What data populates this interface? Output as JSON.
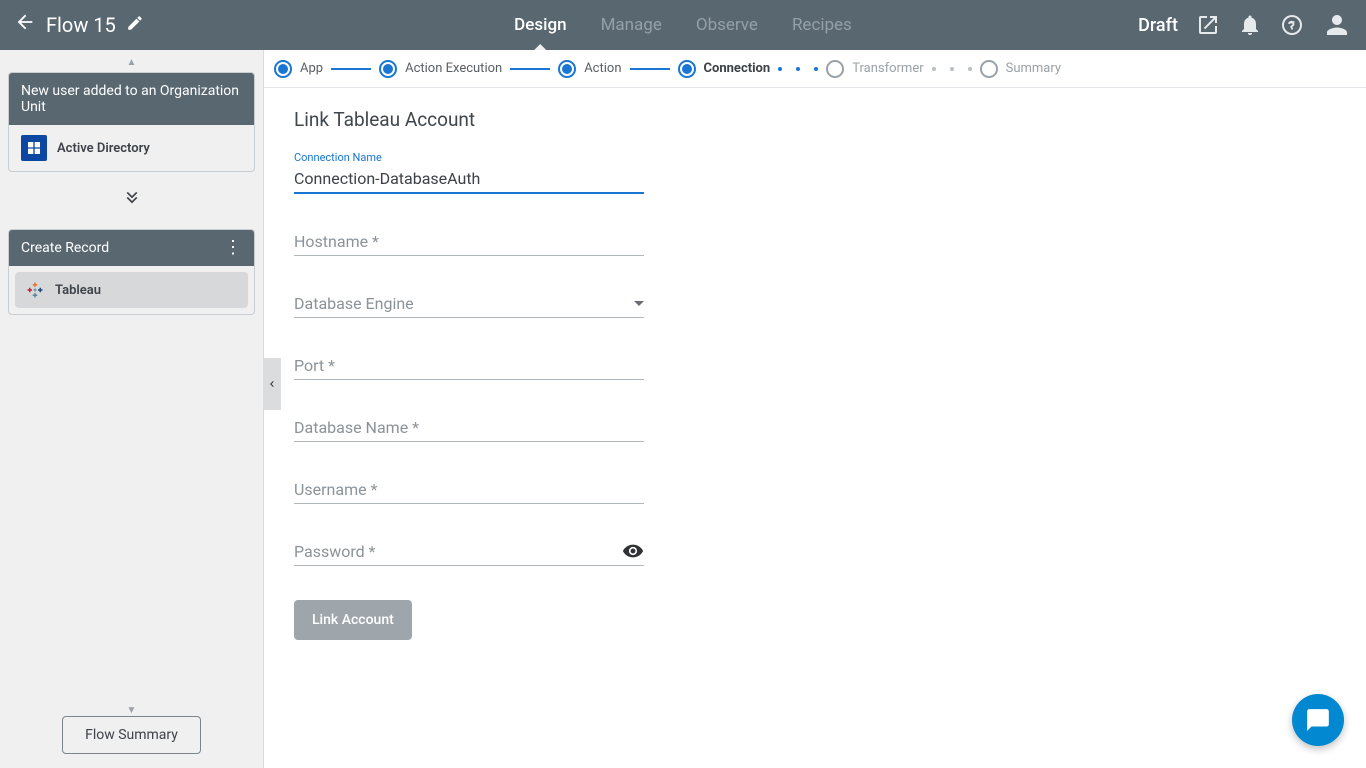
{
  "header": {
    "title": "Flow 15",
    "tabs": [
      "Design",
      "Manage",
      "Observe",
      "Recipes"
    ],
    "active_tab": 0,
    "status": "Draft"
  },
  "sidebar": {
    "trigger": {
      "title": "New user added to an Organization Unit",
      "app": "Active Directory"
    },
    "action": {
      "title": "Create Record",
      "app": "Tableau"
    },
    "summary_button": "Flow Summary"
  },
  "stepper": {
    "steps": [
      {
        "label": "App",
        "state": "done"
      },
      {
        "label": "Action Execution",
        "state": "done"
      },
      {
        "label": "Action",
        "state": "done"
      },
      {
        "label": "Connection",
        "state": "active"
      },
      {
        "label": "Transformer",
        "state": "pending"
      },
      {
        "label": "Summary",
        "state": "pending"
      }
    ]
  },
  "form": {
    "title": "Link Tableau Account",
    "connection_name_label": "Connection Name",
    "connection_name_value": "Connection-DatabaseAuth",
    "hostname_label": "Hostname *",
    "db_engine_label": "Database Engine",
    "port_label": "Port *",
    "db_name_label": "Database Name *",
    "username_label": "Username *",
    "password_label": "Password *",
    "link_button": "Link Account"
  }
}
